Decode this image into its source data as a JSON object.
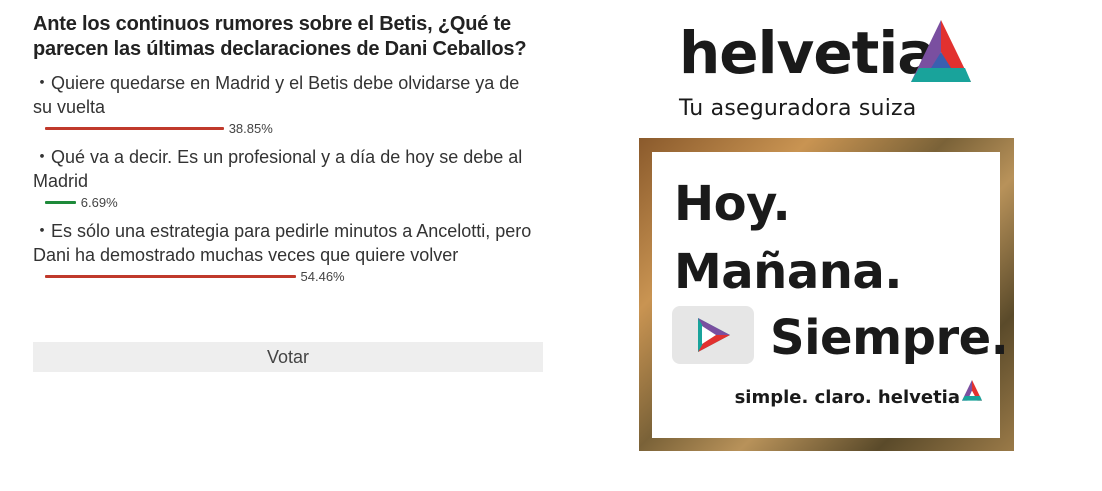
{
  "poll": {
    "question": "Ante los continuos rumores sobre el Betis, ¿Qué te parecen las últimas declaraciones de Dani Ceballos?",
    "bullet": "・",
    "options": [
      {
        "text": "Quiere quedarse en Madrid y el Betis debe olvidarse ya de su vuelta",
        "percent_label": "38.85%",
        "percent": 38.85,
        "color": "#c0392b"
      },
      {
        "text": "Qué va a decir. Es un profesional y a día de hoy se debe al Madrid",
        "percent_label": "6.69%",
        "percent": 6.69,
        "color": "#1e8a3a"
      },
      {
        "text": "Es sólo una estrategia para pedirle minutos a Ancelotti, pero Dani ha demostrado muchas veces que quiere volver",
        "percent_label": "54.46%",
        "percent": 54.46,
        "color": "#c0392b"
      }
    ],
    "vote_label": "Votar"
  },
  "ad": {
    "brand": "helvetia",
    "tagline": "Tu aseguradora suiza",
    "slogan_line1": "Hoy.",
    "slogan_line2": "Mañana.",
    "slogan_line3": "Siempre.",
    "footer": "simple. claro. helvetia",
    "colors": {
      "brand_red": "#e2312f",
      "brand_purple": "#7a4fa0",
      "brand_teal": "#19a39b",
      "brand_blue": "#3a5fb0"
    },
    "icons": [
      "helvetia-logo-icon",
      "play-icon"
    ]
  }
}
